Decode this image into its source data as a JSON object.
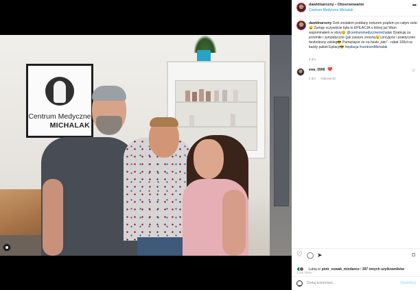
{
  "header": {
    "username": "dawidnarozny",
    "separator": "•",
    "follow_label": "Obserwowanie",
    "location": "Centrum Medyczne Michalak",
    "more_icon": "more-options-icon"
  },
  "photo": {
    "sign_line1": "Centrum Medyczne",
    "sign_line2": "MICHALAK"
  },
  "caption": {
    "username": "dawidnarozny",
    "text_1": "Dziś zostałem poddany torturom prądem po całym ciele😄 Żartuję oczywiście była to EPILACJA o której już Wam wspominałem w story😉 ",
    "mention": "@centrummedycznemichalak",
    "text_2": " Dziękuję za przemiłe i sympatyczne (jak zawsze zresztą😉) przyjęcie i praktycznie bezbolesny zabieg😎 Pamiętajcie że na hasło „lato\" - rabat 100zł na każdy pakiet Epilacji😎 ",
    "hashtag_1": "#epilacja",
    "hashtag_2": "#centrumMichalak",
    "time": "2 dni"
  },
  "comment": {
    "username": "ewa_0998",
    "heart": "❤️",
    "time": "2 dni",
    "reply_label": "Odpowiedz"
  },
  "likes": {
    "prefix": "Lubią to ",
    "user": "piotr_nowak_mixdance",
    "middle": " i ",
    "others": "397 innych użytkowników"
  },
  "post_time": "2 DNI TEMU",
  "add_comment": {
    "placeholder": "Dodaj komentarz...",
    "post_label": "Opublikuj"
  }
}
